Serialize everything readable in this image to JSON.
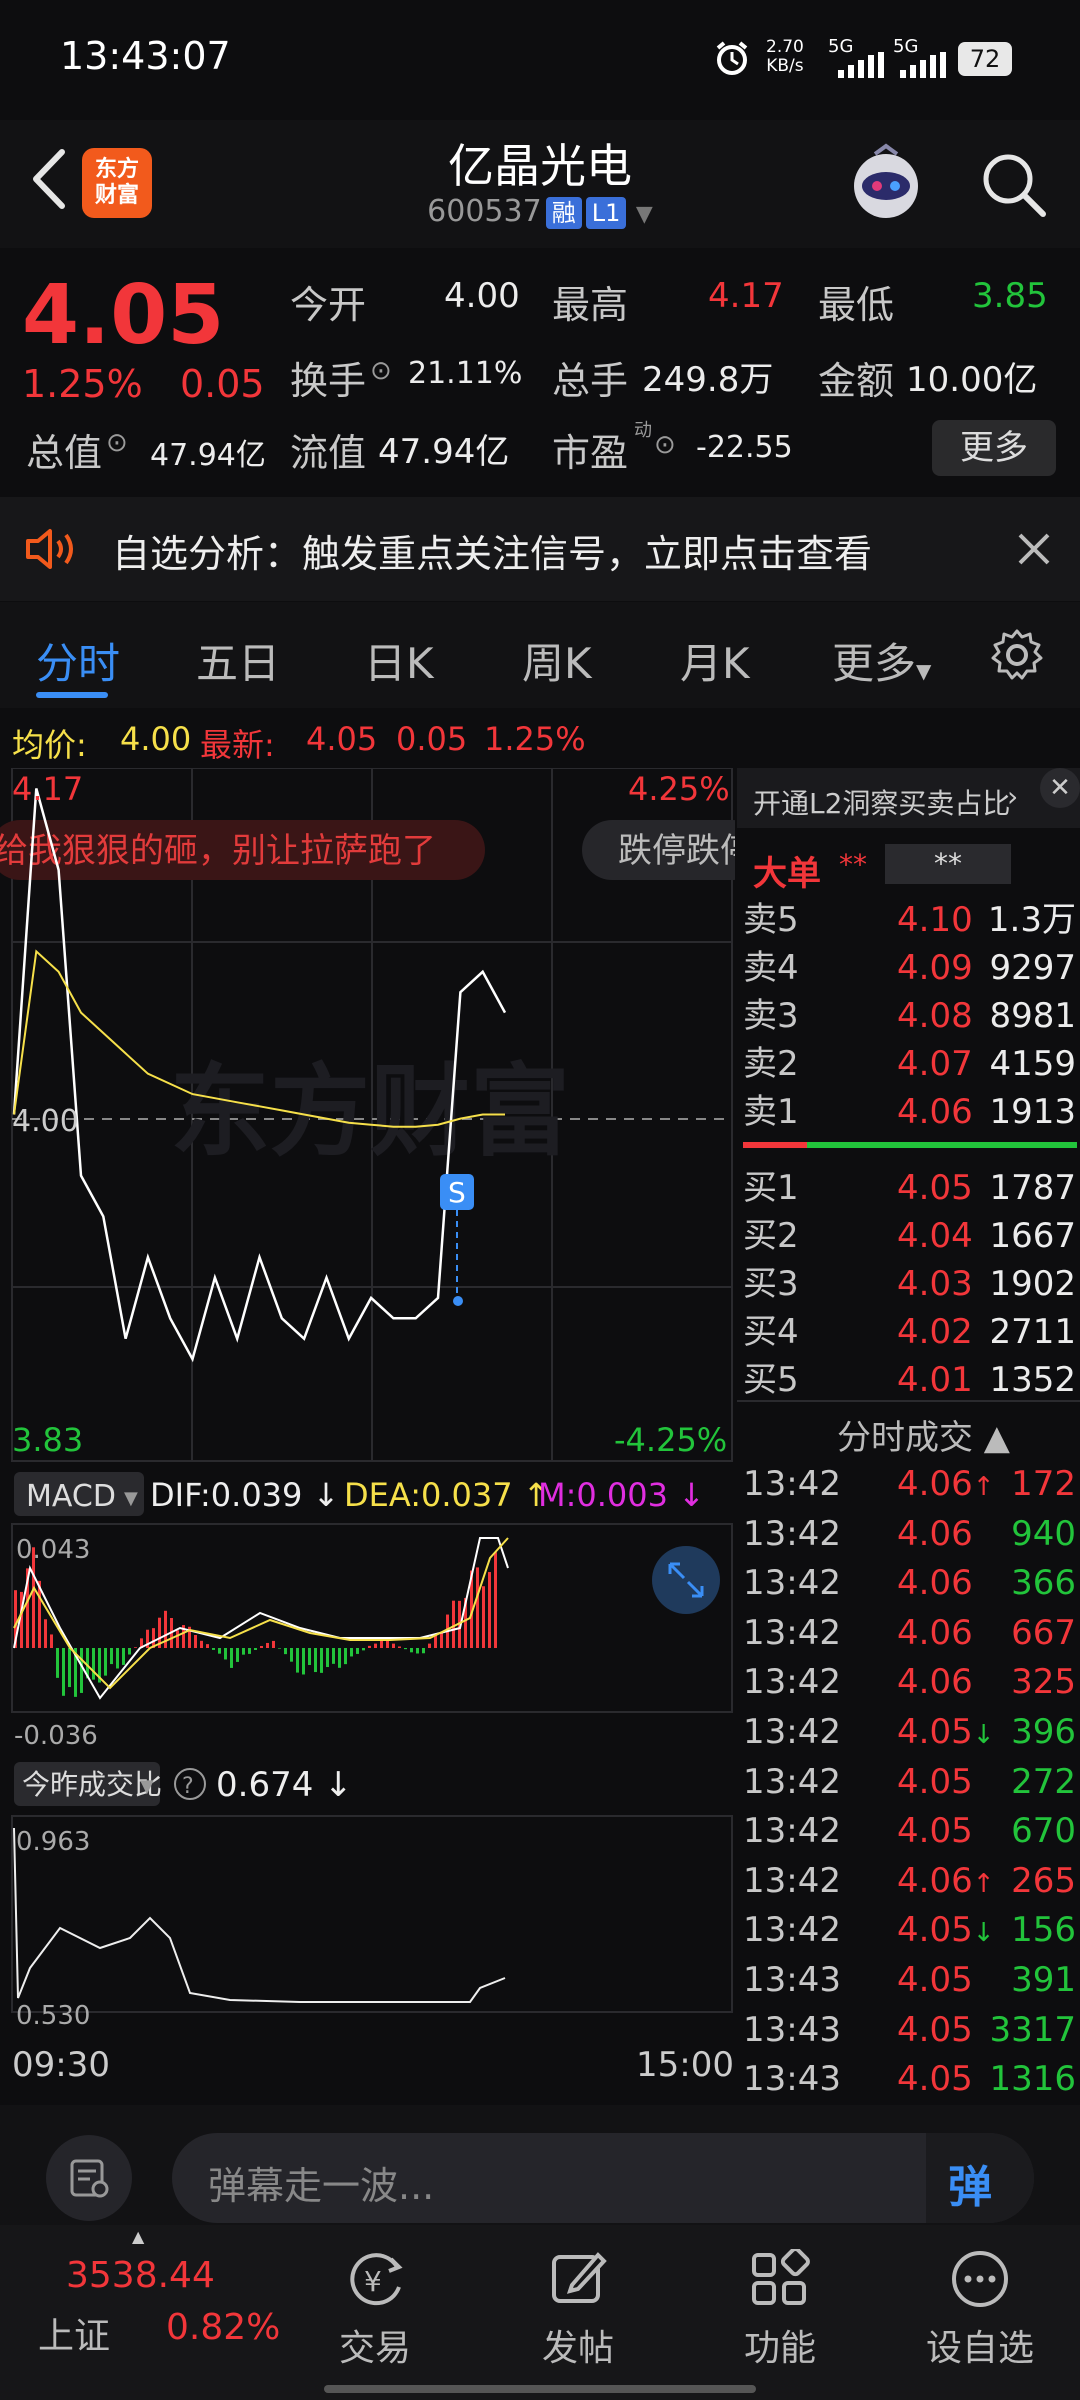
{
  "status_bar": {
    "time": "13:43:07",
    "net_speed": "2.70",
    "net_unit": "KB/s",
    "sig1": "5G",
    "sig2": "5G",
    "battery": "72"
  },
  "header": {
    "logo_text_1": "东方",
    "logo_text_2": "财富",
    "stock_name": "亿晶光电",
    "stock_code": "600537",
    "tag1": "融",
    "tag2": "L1"
  },
  "quote": {
    "price": "4.05",
    "change_pct": "1.25%",
    "change_amt": "0.05",
    "open_label": "今开",
    "open": "4.00",
    "high_label": "最高",
    "high": "4.17",
    "low_label": "最低",
    "low": "3.85",
    "turnover_label": "换手",
    "turnover": "21.11%",
    "volume_label": "总手",
    "volume": "249.8万",
    "amount_label": "金额",
    "amount": "10.00亿",
    "total_cap_label": "总值",
    "total_cap": "47.94亿",
    "float_cap_label": "流值",
    "float_cap": "47.94亿",
    "pe_label": "市盈",
    "pe_sup": "动",
    "pe": "-22.55",
    "more_label": "更多"
  },
  "alert": {
    "text": "自选分析：触发重点关注信号，立即点击查看"
  },
  "tabs": [
    "分时",
    "五日",
    "日K",
    "周K",
    "月K",
    "更多"
  ],
  "info_line": {
    "avg_label": "均价:",
    "avg": "4.00",
    "latest_label": "最新:",
    "latest": "4.05",
    "chg": "0.05",
    "pct": "1.25%"
  },
  "chart": {
    "y_top": "4.17",
    "y_bottom": "3.83",
    "pct_top": "4.25%",
    "pct_bottom": "-4.25%",
    "mid_price": "4.00",
    "danmu_1": "给我狠狠的砸，别让拉萨跑了",
    "danmu_2": "跌停跌停",
    "watermark": "东方财富",
    "marker": "S",
    "macd_label": "MACD",
    "dif": "DIF:0.039",
    "dea": "DEA:0.037",
    "m": "M:0.003",
    "macd_top": "0.043",
    "macd_bottom": "-0.036",
    "ratio_label": "今昨成交比",
    "ratio_value": "0.674",
    "ratio_top": "0.963",
    "ratio_bottom": "0.530",
    "t_start": "09:30",
    "t_end": "15:00",
    "colors": {
      "price": "#ffffff",
      "avg": "#f6e04a",
      "up": "#f2363a",
      "down": "#22c43b"
    }
  },
  "chart_data": {
    "type": "line",
    "x": [
      "09:30",
      "09:35",
      "09:40",
      "09:45",
      "09:50",
      "10:00",
      "10:10",
      "10:20",
      "10:30",
      "10:40",
      "10:50",
      "11:00",
      "11:10",
      "11:20",
      "11:30",
      "13:05",
      "13:15",
      "13:25",
      "13:35",
      "13:38",
      "13:40",
      "13:42",
      "13:43"
    ],
    "series": [
      {
        "name": "最新",
        "values": [
          4.0,
          4.16,
          4.12,
          3.97,
          3.95,
          3.89,
          3.93,
          3.9,
          3.88,
          3.92,
          3.89,
          3.93,
          3.9,
          3.89,
          3.92,
          3.89,
          3.91,
          3.9,
          3.9,
          3.91,
          4.06,
          4.07,
          4.05
        ]
      },
      {
        "name": "均价",
        "values": [
          4.0,
          4.08,
          4.07,
          4.05,
          4.04,
          4.03,
          4.02,
          4.015,
          4.01,
          4.008,
          4.006,
          4.004,
          4.002,
          4.0,
          3.998,
          3.996,
          3.995,
          3.994,
          3.994,
          3.995,
          3.998,
          4.0,
          4.0
        ]
      }
    ],
    "ylim": [
      3.83,
      4.17
    ]
  },
  "orderbook": {
    "l2_label": "开通L2洞察买卖占比",
    "big_label": "大单",
    "big_v1": "**",
    "big_v2": "**",
    "asks": [
      {
        "label": "卖5",
        "price": "4.10",
        "vol": "1.3万"
      },
      {
        "label": "卖4",
        "price": "4.09",
        "vol": "9297"
      },
      {
        "label": "卖3",
        "price": "4.08",
        "vol": "8981"
      },
      {
        "label": "卖2",
        "price": "4.07",
        "vol": "4159"
      },
      {
        "label": "卖1",
        "price": "4.06",
        "vol": "1913"
      }
    ],
    "bids": [
      {
        "label": "买1",
        "price": "4.05",
        "vol": "1787"
      },
      {
        "label": "买2",
        "price": "4.04",
        "vol": "1667"
      },
      {
        "label": "买3",
        "price": "4.03",
        "vol": "1902"
      },
      {
        "label": "买4",
        "price": "4.02",
        "vol": "2711"
      },
      {
        "label": "买5",
        "price": "4.01",
        "vol": "1352"
      }
    ],
    "trades_label": "分时成交",
    "trades": [
      {
        "t": "13:42",
        "p": "4.06",
        "arrow": "↑",
        "v": "172",
        "pc": "red",
        "vc": "red"
      },
      {
        "t": "13:42",
        "p": "4.06",
        "arrow": "",
        "v": "940",
        "pc": "red",
        "vc": "green"
      },
      {
        "t": "13:42",
        "p": "4.06",
        "arrow": "",
        "v": "366",
        "pc": "red",
        "vc": "green"
      },
      {
        "t": "13:42",
        "p": "4.06",
        "arrow": "",
        "v": "667",
        "pc": "red",
        "vc": "red"
      },
      {
        "t": "13:42",
        "p": "4.06",
        "arrow": "",
        "v": "325",
        "pc": "red",
        "vc": "red"
      },
      {
        "t": "13:42",
        "p": "4.05",
        "arrow": "↓",
        "v": "396",
        "pc": "red",
        "vc": "green"
      },
      {
        "t": "13:42",
        "p": "4.05",
        "arrow": "",
        "v": "272",
        "pc": "red",
        "vc": "green"
      },
      {
        "t": "13:42",
        "p": "4.05",
        "arrow": "",
        "v": "670",
        "pc": "red",
        "vc": "green"
      },
      {
        "t": "13:42",
        "p": "4.06",
        "arrow": "↑",
        "v": "265",
        "pc": "red",
        "vc": "red"
      },
      {
        "t": "13:42",
        "p": "4.05",
        "arrow": "↓",
        "v": "156",
        "pc": "red",
        "vc": "green"
      },
      {
        "t": "13:43",
        "p": "4.05",
        "arrow": "",
        "v": "391",
        "pc": "red",
        "vc": "green"
      },
      {
        "t": "13:43",
        "p": "4.05",
        "arrow": "",
        "v": "3317",
        "pc": "red",
        "vc": "green"
      },
      {
        "t": "13:43",
        "p": "4.05",
        "arrow": "",
        "v": "1316",
        "pc": "red",
        "vc": "green"
      }
    ]
  },
  "comment": {
    "placeholder": "弹幕走一波...",
    "send_label": "弹"
  },
  "nav": {
    "index_value": "3538.44",
    "index_name": "上证",
    "index_pct": "0.82%",
    "items": [
      {
        "label": "交易",
        "icon": "trade-icon"
      },
      {
        "label": "发帖",
        "icon": "edit-icon"
      },
      {
        "label": "功能",
        "icon": "grid-icon"
      },
      {
        "label": "设自选",
        "icon": "more-icon"
      }
    ]
  }
}
